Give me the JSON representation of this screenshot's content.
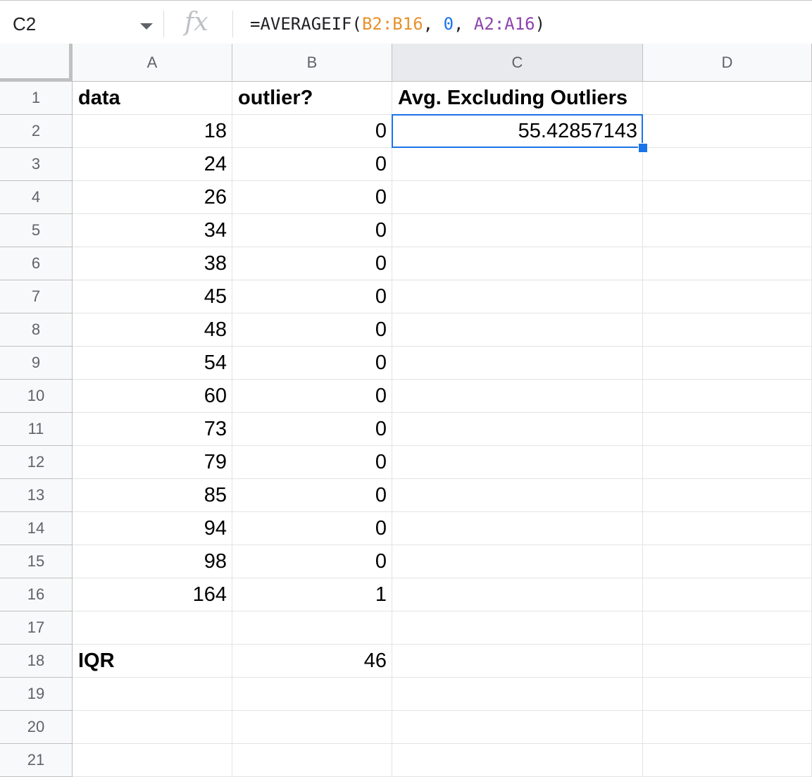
{
  "name_box": "C2",
  "formula": {
    "prefix": "=AVERAGEIF(",
    "range1": "B2:B16",
    "sep1": ", ",
    "criterion": "0",
    "sep2": ", ",
    "range2": "A2:A16",
    "suffix": ")",
    "colors": {
      "range1": "#e8912d",
      "criterion": "#1a73e8",
      "range2": "#8e44ad"
    }
  },
  "columns": [
    "A",
    "B",
    "C",
    "D"
  ],
  "selected_column": "C",
  "selected_cell": "C2",
  "rows": [
    {
      "num": "1",
      "A": "data",
      "B": "outlier?",
      "C": "Avg. Excluding Outliers",
      "D": ""
    },
    {
      "num": "2",
      "A": "18",
      "B": "0",
      "C": "55.42857143",
      "D": ""
    },
    {
      "num": "3",
      "A": "24",
      "B": "0",
      "C": "",
      "D": ""
    },
    {
      "num": "4",
      "A": "26",
      "B": "0",
      "C": "",
      "D": ""
    },
    {
      "num": "5",
      "A": "34",
      "B": "0",
      "C": "",
      "D": ""
    },
    {
      "num": "6",
      "A": "38",
      "B": "0",
      "C": "",
      "D": ""
    },
    {
      "num": "7",
      "A": "45",
      "B": "0",
      "C": "",
      "D": ""
    },
    {
      "num": "8",
      "A": "48",
      "B": "0",
      "C": "",
      "D": ""
    },
    {
      "num": "9",
      "A": "54",
      "B": "0",
      "C": "",
      "D": ""
    },
    {
      "num": "10",
      "A": "60",
      "B": "0",
      "C": "",
      "D": ""
    },
    {
      "num": "11",
      "A": "73",
      "B": "0",
      "C": "",
      "D": ""
    },
    {
      "num": "12",
      "A": "79",
      "B": "0",
      "C": "",
      "D": ""
    },
    {
      "num": "13",
      "A": "85",
      "B": "0",
      "C": "",
      "D": ""
    },
    {
      "num": "14",
      "A": "94",
      "B": "0",
      "C": "",
      "D": ""
    },
    {
      "num": "15",
      "A": "98",
      "B": "0",
      "C": "",
      "D": ""
    },
    {
      "num": "16",
      "A": "164",
      "B": "1",
      "C": "",
      "D": ""
    },
    {
      "num": "17",
      "A": "",
      "B": "",
      "C": "",
      "D": ""
    },
    {
      "num": "18",
      "A": "IQR",
      "B": "46",
      "C": "",
      "D": ""
    },
    {
      "num": "19",
      "A": "",
      "B": "",
      "C": "",
      "D": ""
    },
    {
      "num": "20",
      "A": "",
      "B": "",
      "C": "",
      "D": ""
    },
    {
      "num": "21",
      "A": "",
      "B": "",
      "C": "",
      "D": ""
    }
  ]
}
